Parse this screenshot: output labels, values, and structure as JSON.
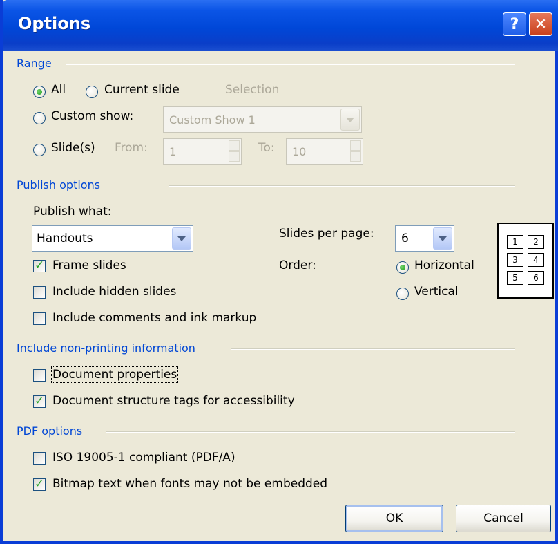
{
  "window": {
    "title": "Options",
    "help_glyph": "?",
    "close_glyph": "✕"
  },
  "range": {
    "label": "Range",
    "all": "All",
    "current_slide": "Current slide",
    "selection": "Selection",
    "custom_show": "Custom show:",
    "custom_show_value": "Custom Show 1",
    "slides": "Slide(s)",
    "from_label": "From:",
    "from_value": "1",
    "to_label": "To:",
    "to_value": "10"
  },
  "publish": {
    "label": "Publish options",
    "publish_what": "Publish what:",
    "publish_value": "Handouts",
    "slides_per_page": "Slides per page:",
    "slides_per_page_value": "6",
    "order": "Order:",
    "horizontal": "Horizontal",
    "vertical": "Vertical",
    "frame_slides": "Frame slides",
    "include_hidden": "Include hidden slides",
    "include_comments": "Include comments and ink markup",
    "preview_cells": [
      "1",
      "2",
      "3",
      "4",
      "5",
      "6"
    ]
  },
  "nonprinting": {
    "label": "Include non-printing information",
    "doc_props": "Document properties",
    "doc_tags": "Document structure tags for accessibility"
  },
  "pdf": {
    "label": "PDF options",
    "iso": "ISO 19005-1 compliant (PDF/A)",
    "bitmap": "Bitmap text when fonts may not be embedded"
  },
  "buttons": {
    "ok": "OK",
    "cancel": "Cancel"
  }
}
